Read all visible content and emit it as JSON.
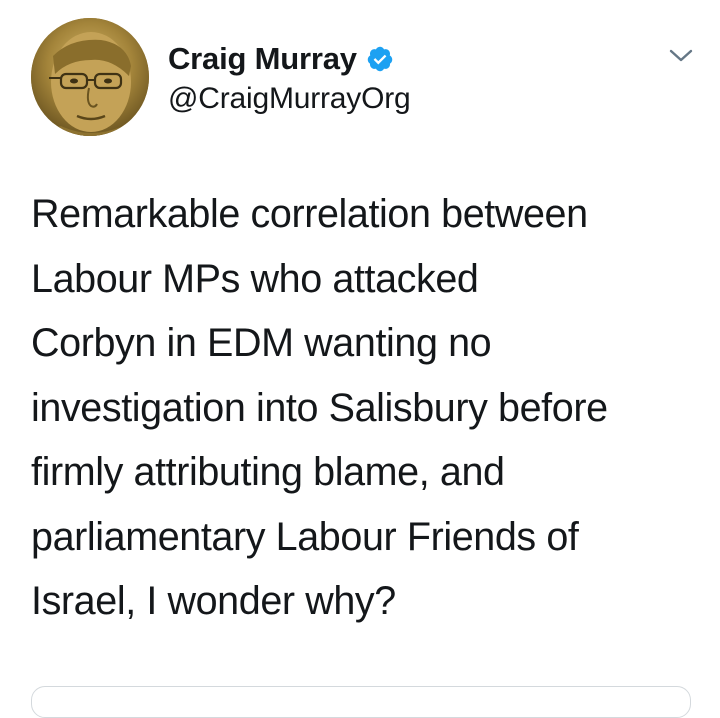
{
  "tweet": {
    "author": {
      "display_name": "Craig Murray",
      "handle": "@CraigMurrayOrg",
      "verified": true,
      "avatar_icon": "avatar-photo"
    },
    "menu_icon": "chevron-down-icon",
    "text_lines": [
      "Remarkable correlation between",
      "Labour MPs who attacked",
      "Corbyn in EDM wanting no",
      "investigation into Salisbury before",
      "firmly attributing blame, and",
      "parliamentary Labour Friends of",
      "Israel, I wonder why?"
    ]
  },
  "colors": {
    "text": "#14171a",
    "verified_blue": "#1da1f2",
    "caret_gray": "#657786",
    "card_border": "#d4d9dd"
  }
}
